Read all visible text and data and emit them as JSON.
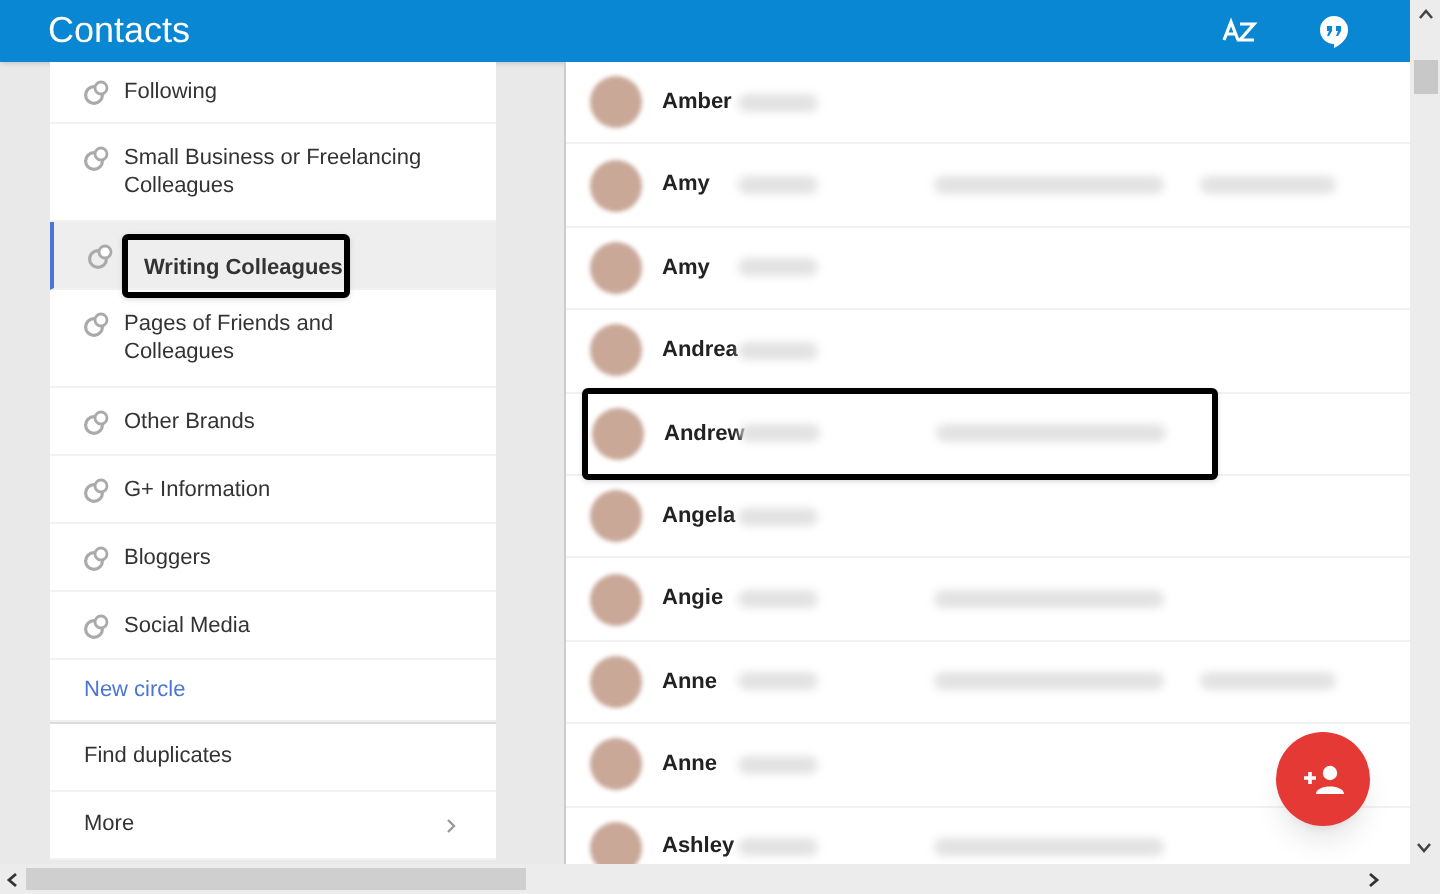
{
  "app_bar": {
    "title": "Contacts"
  },
  "circles": [
    {
      "label": "Following",
      "selected": false,
      "highlighted": false
    },
    {
      "label": "Small Business or Freelancing Colleagues",
      "selected": false,
      "highlighted": false
    },
    {
      "label": "Writing Colleagues",
      "selected": true,
      "highlighted": true
    },
    {
      "label": "Pages of Friends and Colleagues",
      "selected": false,
      "highlighted": false
    },
    {
      "label": "Other Brands",
      "selected": false,
      "highlighted": false
    },
    {
      "label": "G+ Information",
      "selected": false,
      "highlighted": false
    },
    {
      "label": "Bloggers",
      "selected": false,
      "highlighted": false
    },
    {
      "label": "Social Media",
      "selected": false,
      "highlighted": false
    }
  ],
  "new_circle": "New circle",
  "menu": [
    {
      "label": "Find duplicates",
      "kind": "plain"
    },
    {
      "label": "More",
      "kind": "submenu"
    }
  ],
  "contacts": [
    {
      "first_name": "Amber",
      "email_shown": false,
      "phone_shown": false,
      "highlighted": false
    },
    {
      "first_name": "Amy",
      "email_shown": true,
      "phone_shown": true,
      "highlighted": false
    },
    {
      "first_name": "Amy",
      "email_shown": false,
      "phone_shown": false,
      "highlighted": false
    },
    {
      "first_name": "Andrea",
      "email_shown": false,
      "phone_shown": false,
      "highlighted": false
    },
    {
      "first_name": "Andrew",
      "email_shown": true,
      "phone_shown": false,
      "highlighted": true
    },
    {
      "first_name": "Angela",
      "email_shown": false,
      "phone_shown": false,
      "highlighted": false
    },
    {
      "first_name": "Angie",
      "email_shown": true,
      "phone_shown": false,
      "highlighted": false
    },
    {
      "first_name": "Anne",
      "email_shown": true,
      "phone_shown": true,
      "highlighted": false
    },
    {
      "first_name": "Anne",
      "email_shown": false,
      "phone_shown": false,
      "highlighted": false
    },
    {
      "first_name": "Ashley",
      "email_shown": true,
      "phone_shown": false,
      "highlighted": false
    }
  ]
}
